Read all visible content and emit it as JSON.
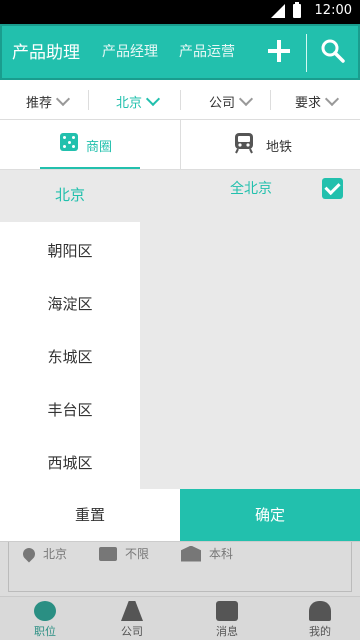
{
  "status": {
    "time": "12:00"
  },
  "topbar": {
    "title": "产品助理",
    "tabs": [
      "产品经理",
      "产品运营"
    ]
  },
  "filters": [
    {
      "label": "推荐"
    },
    {
      "label": "北京"
    },
    {
      "label": "公司"
    },
    {
      "label": "要求"
    }
  ],
  "segments": {
    "left": "商圈",
    "right": "地铁"
  },
  "left_panel": {
    "header": "北京",
    "items": [
      "朝阳区",
      "海淀区",
      "东城区",
      "丰台区",
      "西城区"
    ]
  },
  "right_panel": {
    "item": "全北京"
  },
  "actions": {
    "reset": "重置",
    "confirm": "确定"
  },
  "card_meta": {
    "city": "北京",
    "experience": "不限",
    "education": "本科"
  },
  "bottom_nav": [
    "职位",
    "公司",
    "消息",
    "我的"
  ],
  "colors": {
    "accent": "#22c0ad"
  }
}
